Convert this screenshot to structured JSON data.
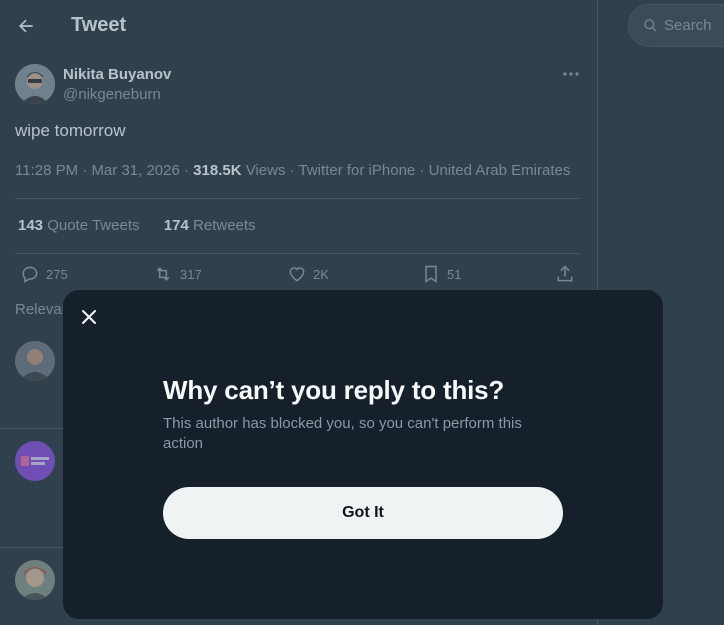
{
  "header": {
    "title": "Tweet"
  },
  "tweet": {
    "author_name": "Nikita Buyanov",
    "author_handle": "@nikgeneburn",
    "text": "wipe tomorrow",
    "time": "11:28 PM",
    "date": "Mar 31, 2026",
    "views_count": "318.5K",
    "views_label": "Views",
    "source": "Twitter for iPhone",
    "location": "United Arab Emirates",
    "quote_count": "143",
    "quote_label": "Quote Tweets",
    "retweet_count": "174",
    "retweet_label": "Retweets",
    "actions": {
      "replies": "275",
      "retweets": "317",
      "likes": "2K",
      "bookmarks": "51"
    }
  },
  "replies_sort_label": "Relevan",
  "search": {
    "placeholder": "Search"
  },
  "modal": {
    "title": "Why can’t you reply to this?",
    "body": "This author has blocked you, so you can't perform this action",
    "button_label": "Got It"
  },
  "colors": {
    "background": "#15202b",
    "text_primary": "#f7f9f9",
    "text_secondary": "#8b98a5",
    "border": "#38444d",
    "button_bg": "#eff3f4"
  },
  "icons": [
    "back-arrow-icon",
    "more-icon",
    "reply-icon",
    "retweet-icon",
    "like-icon",
    "bookmark-icon",
    "share-icon",
    "search-icon",
    "close-icon"
  ]
}
